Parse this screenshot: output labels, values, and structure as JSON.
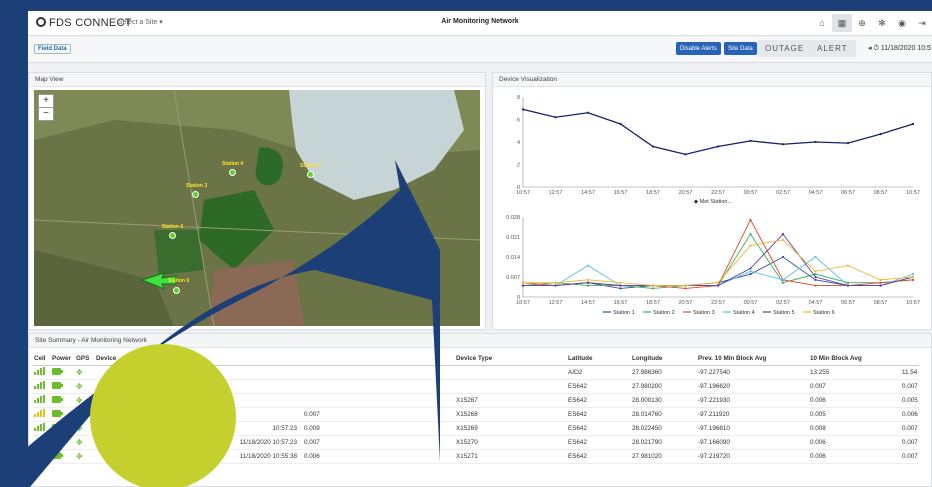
{
  "header": {
    "brand": "FDS CONNECT",
    "site_select": "Select a Site ▾",
    "title": "Air Monitoring Network",
    "icons": [
      "home-icon",
      "grid-icon",
      "globe-icon",
      "gear-icon",
      "user-icon",
      "logout-icon"
    ]
  },
  "toolbar": {
    "logo_text": "Field Data",
    "disable_alerts": "Disable Alerts",
    "site_data": "Site Data",
    "outage": "OUTAGE",
    "alert": "ALERT",
    "timestamp": "◂ ⏱ 11/18/2020 10:57:23"
  },
  "map_panel": {
    "title": "Map View",
    "zoom_in": "+",
    "zoom_out": "−",
    "stations": [
      {
        "label": "Station 4"
      },
      {
        "label": "Station 5"
      },
      {
        "label": "Station 3"
      },
      {
        "label": "Station 2"
      },
      {
        "label": "Station 6"
      }
    ]
  },
  "viz_panel": {
    "title": "Device Visualization",
    "time_ticks": [
      "10:57",
      "12:57",
      "14:57",
      "16:57",
      "18:57",
      "20:57",
      "22:57",
      "00:57",
      "02:57",
      "04:57",
      "06:57",
      "08:57",
      "10:57"
    ],
    "top_ticks": [
      "8",
      "6",
      "4",
      "2",
      "0"
    ],
    "bottom_ticks": [
      "0.028",
      "0.021",
      "0.014",
      "0.007",
      "0"
    ],
    "met_legend": "Met Station...",
    "legend": [
      "Station 1",
      "Station 2",
      "Station 3",
      "Station 4",
      "Station 5",
      "Station 6"
    ]
  },
  "colors": {
    "accent": "#2863b8",
    "band": "#1c3f78",
    "circle": "#c5cf2e",
    "met": "#1b1e6e",
    "s1": "#2f4fa8",
    "s2": "#3bb05a",
    "s3": "#e0452a",
    "s4": "#5bc0e8",
    "s5": "#5a3fa0",
    "s6": "#f2b632"
  },
  "chart_data": [
    {
      "type": "line",
      "title": "",
      "xlabel": "",
      "ylabel": "",
      "x": [
        "10:57",
        "12:57",
        "14:57",
        "16:57",
        "18:57",
        "20:57",
        "22:57",
        "00:57",
        "02:57",
        "04:57",
        "06:57",
        "08:57",
        "10:57"
      ],
      "ylim": [
        0,
        8
      ],
      "series": [
        {
          "name": "Met Station...",
          "values": [
            6.9,
            6.2,
            6.6,
            5.6,
            3.6,
            2.9,
            3.6,
            4.1,
            3.8,
            4.0,
            3.9,
            4.7,
            5.6
          ]
        }
      ]
    },
    {
      "type": "line",
      "title": "",
      "x": [
        "10:57",
        "12:57",
        "14:57",
        "16:57",
        "18:57",
        "20:57",
        "22:57",
        "00:57",
        "02:57",
        "04:57",
        "06:57",
        "08:57",
        "10:57"
      ],
      "ylim": [
        0,
        0.028
      ],
      "series": [
        {
          "name": "Station 1",
          "values": [
            0.004,
            0.004,
            0.005,
            0.003,
            0.004,
            0.004,
            0.005,
            0.008,
            0.014,
            0.006,
            0.004,
            0.004,
            0.007
          ]
        },
        {
          "name": "Station 2",
          "values": [
            0.004,
            0.005,
            0.004,
            0.004,
            0.003,
            0.004,
            0.004,
            0.022,
            0.005,
            0.008,
            0.005,
            0.005,
            0.006
          ]
        },
        {
          "name": "Station 3",
          "values": [
            0.005,
            0.004,
            0.005,
            0.004,
            0.004,
            0.003,
            0.004,
            0.027,
            0.006,
            0.004,
            0.004,
            0.005,
            0.006
          ]
        },
        {
          "name": "Station 4",
          "values": [
            0.004,
            0.004,
            0.011,
            0.004,
            0.004,
            0.004,
            0.004,
            0.009,
            0.006,
            0.014,
            0.004,
            0.004,
            0.008
          ]
        },
        {
          "name": "Station 5",
          "values": [
            0.004,
            0.004,
            0.005,
            0.004,
            0.004,
            0.004,
            0.004,
            0.01,
            0.022,
            0.007,
            0.004,
            0.004,
            0.007
          ]
        },
        {
          "name": "Station 6",
          "values": [
            0.005,
            0.005,
            0.006,
            0.005,
            0.004,
            0.004,
            0.005,
            0.018,
            0.02,
            0.009,
            0.011,
            0.006,
            0.007
          ]
        }
      ]
    }
  ],
  "summary": {
    "title": "Site Summary - Air Monitoring Network",
    "headers": [
      "Cell",
      "Power",
      "GPS",
      "Device",
      "",
      "",
      "Device Type",
      "Latitude",
      "Longitude",
      "Prev. 10 Min Block Avg",
      "10 Min Block Avg"
    ],
    "rows": [
      {
        "time": "",
        "value": "",
        "id": "",
        "type": "AIO2",
        "lat": "27.986360",
        "lon": "-97.227540",
        "prev": "13.255",
        "avg": "11.54"
      },
      {
        "time": "",
        "value": "",
        "id": "",
        "type": "ES642",
        "lat": "27.980200",
        "lon": "-97.196620",
        "prev": "0.007",
        "avg": "0.007"
      },
      {
        "time": "",
        "value": "",
        "id": "X15267",
        "type": "ES642",
        "lat": "28.000130",
        "lon": "-97.221930",
        "prev": "0.006",
        "avg": "0.005"
      },
      {
        "time": "",
        "value": "0.007",
        "id": "X15268",
        "type": "ES642",
        "lat": "28.014760",
        "lon": "-97.211920",
        "prev": "0.005",
        "avg": "0.006"
      },
      {
        "time": "10:57:23",
        "value": "0.009",
        "id": "X15269",
        "type": "ES642",
        "lat": "28.022450",
        "lon": "-97.196810",
        "prev": "0.008",
        "avg": "0.007"
      },
      {
        "time": "11/18/2020 10:57:23",
        "value": "0.007",
        "id": "X15270",
        "type": "ES642",
        "lat": "28.021790",
        "lon": "-97.166090",
        "prev": "0.006",
        "avg": "0.007"
      },
      {
        "time": "11/18/2020 10:55:38",
        "value": "0.006",
        "id": "X15271",
        "type": "ES642",
        "lat": "27.981020",
        "lon": "-97.219720",
        "prev": "0.006",
        "avg": "0.007"
      }
    ]
  }
}
